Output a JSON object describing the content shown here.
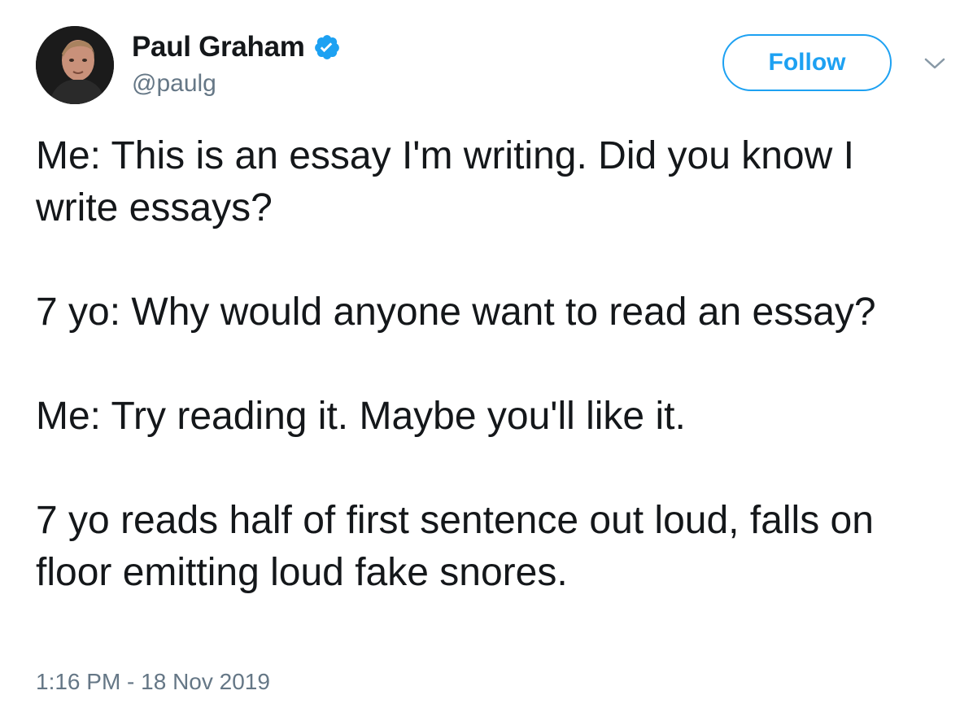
{
  "user": {
    "display_name": "Paul Graham",
    "handle": "@paulg",
    "verified_icon": "verified-badge-icon",
    "avatar": "avatar-photo"
  },
  "actions": {
    "follow_label": "Follow",
    "menu_icon": "chevron-down-icon"
  },
  "tweet": {
    "paragraphs": [
      "Me: This is an essay I'm writing. Did you know I write essays?",
      "7 yo: Why would anyone want to read an essay?",
      "Me: Try reading it. Maybe you'll like it.",
      "7 yo reads half of first sentence out loud, falls on floor emitting loud fake snores."
    ],
    "timestamp": "1:16 PM - 18 Nov 2019"
  },
  "colors": {
    "accent": "#1da1f2",
    "text": "#14171a",
    "muted": "#657786",
    "background": "#ffffff"
  }
}
